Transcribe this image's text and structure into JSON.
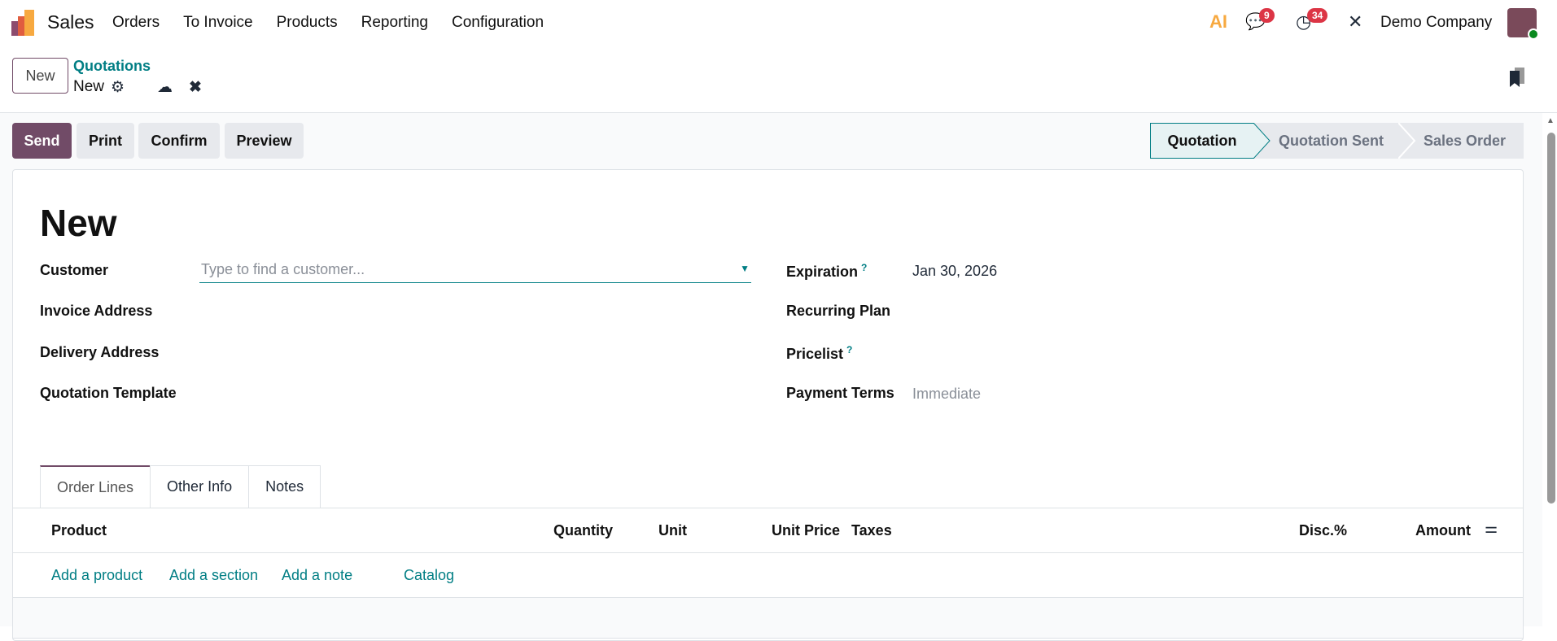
{
  "navbar": {
    "app": "Sales",
    "menu": [
      "Orders",
      "To Invoice",
      "Products",
      "Reporting",
      "Configuration"
    ],
    "ai_label": "AI",
    "messages_count": "9",
    "activities_count": "34",
    "company": "Demo Company"
  },
  "control": {
    "new_button": "New",
    "breadcrumb_parent": "Quotations",
    "breadcrumb_current": "New"
  },
  "actions": [
    "Send",
    "Print",
    "Confirm",
    "Preview"
  ],
  "statusbar": {
    "steps": [
      "Quotation",
      "Quotation Sent",
      "Sales Order"
    ],
    "active": "Quotation"
  },
  "form": {
    "title": "New",
    "left": {
      "customer_label": "Customer",
      "customer_placeholder": "Type to find a customer...",
      "invoice_label": "Invoice Address",
      "delivery_label": "Delivery Address",
      "template_label": "Quotation Template"
    },
    "right": {
      "expiration_label": "Expiration",
      "expiration_value": "Jan 30, 2026",
      "recurring_label": "Recurring Plan",
      "pricelist_label": "Pricelist",
      "terms_label": "Payment Terms",
      "terms_value": "Immediate",
      "help": "?"
    }
  },
  "tabs": [
    "Order Lines",
    "Other Info",
    "Notes"
  ],
  "table": {
    "columns": [
      "Product",
      "Quantity",
      "Unit",
      "Unit Price",
      "Taxes",
      "Disc.%",
      "Amount"
    ],
    "links": [
      "Add a product",
      "Add a section",
      "Add a note",
      "Catalog"
    ]
  },
  "colors": {
    "brand": "#714b67",
    "accent": "#017e84",
    "badge": "#dc3545"
  }
}
